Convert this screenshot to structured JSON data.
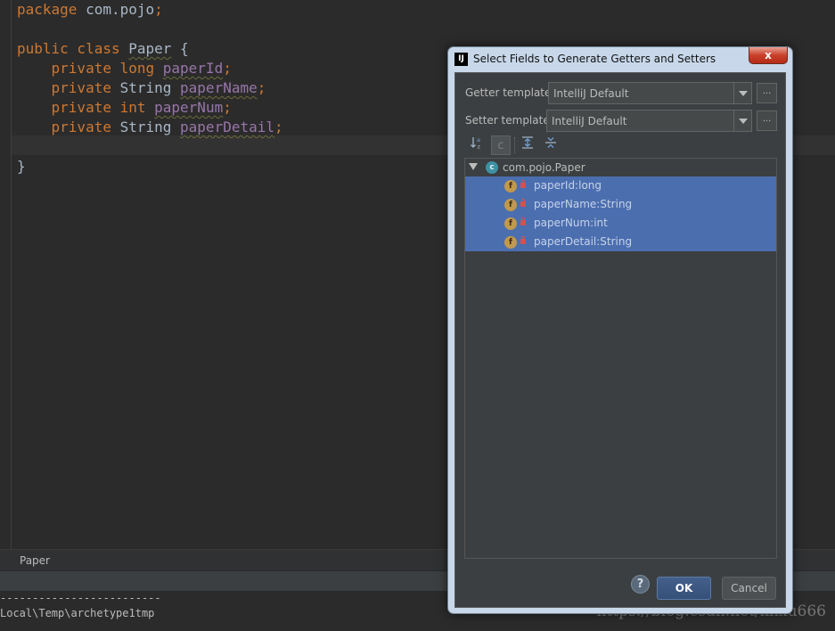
{
  "editor": {
    "code_lines": [
      [
        {
          "t": "package",
          "c": "kw"
        },
        {
          "t": " com.pojo",
          "c": ""
        },
        {
          "t": ";",
          "c": "kw"
        }
      ],
      [],
      [
        {
          "t": "public class",
          "c": "kw"
        },
        {
          "t": " ",
          "c": ""
        },
        {
          "t": "Paper",
          "c": "cls"
        },
        {
          "t": " {",
          "c": ""
        }
      ],
      [
        {
          "t": "    ",
          "c": ""
        },
        {
          "t": "private long",
          "c": "kw"
        },
        {
          "t": " ",
          "c": ""
        },
        {
          "t": "paperId",
          "c": "fld"
        },
        {
          "t": ";",
          "c": "kw"
        }
      ],
      [
        {
          "t": "    ",
          "c": ""
        },
        {
          "t": "private",
          "c": "kw"
        },
        {
          "t": " String ",
          "c": ""
        },
        {
          "t": "paperName",
          "c": "fld"
        },
        {
          "t": ";",
          "c": "kw"
        }
      ],
      [
        {
          "t": "    ",
          "c": ""
        },
        {
          "t": "private int",
          "c": "kw"
        },
        {
          "t": " ",
          "c": ""
        },
        {
          "t": "paperNum",
          "c": "fld"
        },
        {
          "t": ";",
          "c": "kw"
        }
      ],
      [
        {
          "t": "    ",
          "c": ""
        },
        {
          "t": "private",
          "c": "kw"
        },
        {
          "t": " String ",
          "c": ""
        },
        {
          "t": "paperDetail",
          "c": "fld"
        },
        {
          "t": ";",
          "c": "kw"
        }
      ],
      [],
      [
        {
          "t": "}",
          "c": ""
        }
      ]
    ],
    "breadcrumb": "Paper"
  },
  "console": {
    "line1": "-------------------------",
    "line2": "Local\\Temp\\archetype1tmp"
  },
  "watermark": "https://blog.csdn.net/khxu666",
  "dialog": {
    "icon_letter": "IJ",
    "title": "Select Fields to Generate Getters and Setters",
    "close_label": "x",
    "getter_label": "Getter template:",
    "getter_value": "IntelliJ Default",
    "setter_label": "Setter template:",
    "setter_value": "IntelliJ Default",
    "dots_label": "...",
    "toolbar": {
      "sort_icon": "sort-alpha-icon",
      "class_icon": "c",
      "expand_icon": "expand-all-icon",
      "collapse_icon": "collapse-all-icon"
    },
    "tree": {
      "root_icon": "c",
      "root": "com.pojo.Paper",
      "field_icon": "f",
      "fields": [
        "paperId:long",
        "paperName:String",
        "paperNum:int",
        "paperDetail:String"
      ]
    },
    "help_label": "?",
    "ok_label": "OK",
    "cancel_label": "Cancel"
  },
  "colors": {
    "selection": "#4b6eaf",
    "keyword": "#cc7832",
    "field": "#9876aa",
    "text": "#a9b7c6"
  }
}
